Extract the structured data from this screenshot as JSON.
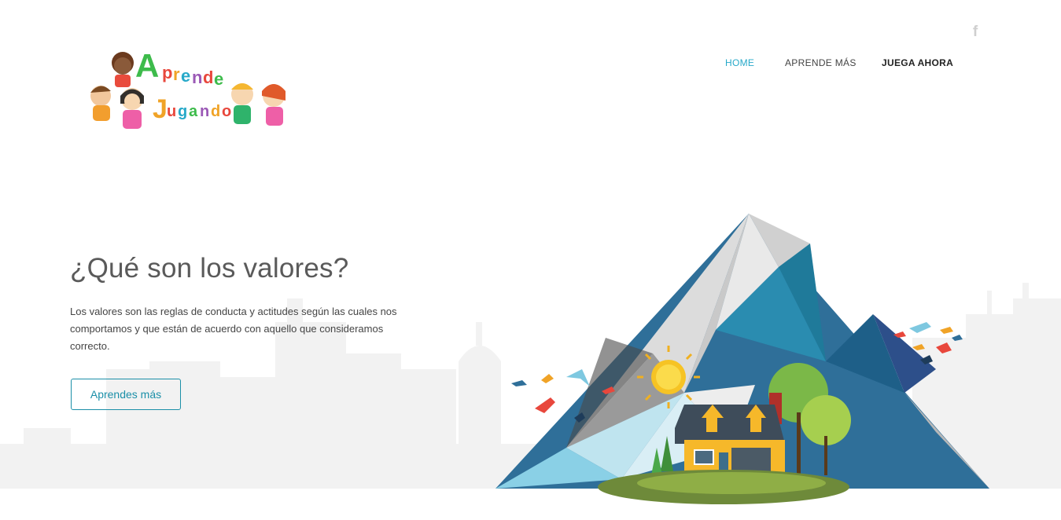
{
  "brand": {
    "logo_line1": "Aprende",
    "logo_line2": "Jugando"
  },
  "social": {
    "facebook_glyph": "f",
    "facebook_icon": "facebook-icon"
  },
  "nav": {
    "items": [
      {
        "label": "HOME",
        "active": true
      },
      {
        "label": "APRENDE MÁS",
        "active": false
      },
      {
        "label": "JUEGA AHORA",
        "active": false
      }
    ]
  },
  "hero": {
    "title": "¿Qué son los valores?",
    "text": "Los valores son las reglas de conducta y actitudes según las cuales nos comportamos y que están de acuerdo con aquello que consideramos correcto.",
    "button_label": "Aprendes más"
  },
  "colors": {
    "accent": "#27a9c9",
    "button": "#1b8fa8",
    "skyline": "#f2f2f2"
  }
}
